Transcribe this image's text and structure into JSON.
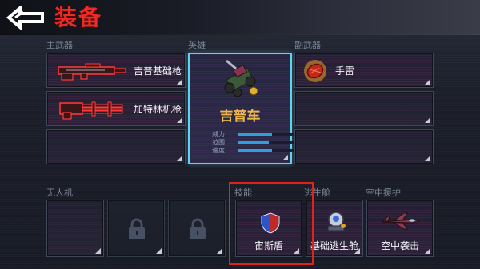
{
  "header": {
    "title": "装备",
    "back_icon": "back-arrow-icon",
    "accent_color": "#ee2a24"
  },
  "sections": {
    "primary_weapon": "主武器",
    "hero": "英雄",
    "secondary_weapon": "副武器",
    "drone": "无人机",
    "skill": "技能",
    "escape_pod": "逃生舱",
    "air_support": "空中援护"
  },
  "primary_weapons": [
    {
      "name": "吉普基础枪",
      "icon": "jeep-basic-gun-icon"
    },
    {
      "name": "加特林机枪",
      "icon": "gatling-gun-icon"
    },
    {
      "name": "",
      "icon": ""
    }
  ],
  "secondary_weapons": [
    {
      "name": "手雷",
      "icon": "grenade-icon"
    },
    {
      "name": "",
      "icon": ""
    },
    {
      "name": "",
      "icon": ""
    }
  ],
  "hero": {
    "name": "吉普车",
    "icon": "jeep-vehicle-icon",
    "stats": [
      {
        "label": "威力",
        "level": 0.62
      },
      {
        "label": "范围",
        "level": 0.55
      },
      {
        "label": "速度",
        "level": 0.62
      }
    ],
    "border_color": "#5fd3f0",
    "name_color": "#f0b84a"
  },
  "drones": [
    {
      "state": "empty",
      "icon": ""
    },
    {
      "state": "locked",
      "icon": "padlock-icon"
    },
    {
      "state": "locked",
      "icon": "padlock-icon"
    }
  ],
  "skill": {
    "name": "宙斯盾",
    "icon": "aegis-shield-icon",
    "selected": true
  },
  "escape_pod": {
    "name": "基础逃生舱",
    "icon": "escape-pod-icon"
  },
  "air_support": {
    "name": "空中袭击",
    "icon": "fighter-jet-icon"
  },
  "selection_color": "#e0221b"
}
